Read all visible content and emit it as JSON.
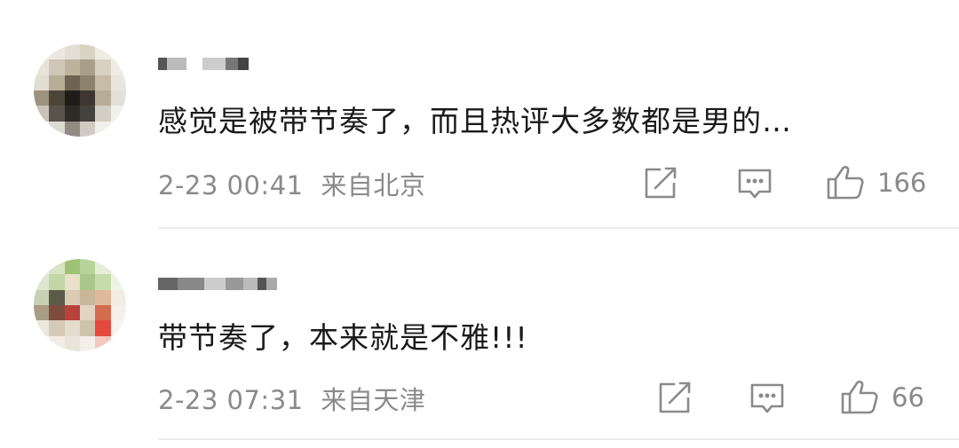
{
  "comments": [
    {
      "text": "感觉是被带节奏了，而且热评大多数都是男的…",
      "timestamp": "2-23 00:41",
      "location": "来自北京",
      "likes": "166"
    },
    {
      "text": "带节奏了，本来就是不雅!!!",
      "timestamp": "2-23 07:31",
      "location": "来自天津",
      "likes": "66"
    }
  ],
  "icons": {
    "share": "share-icon",
    "reply": "comment-icon",
    "like": "thumbs-up-icon"
  },
  "colors": {
    "text": "#1a1a1a",
    "meta": "#8a8a8a",
    "divider": "#ececec"
  }
}
